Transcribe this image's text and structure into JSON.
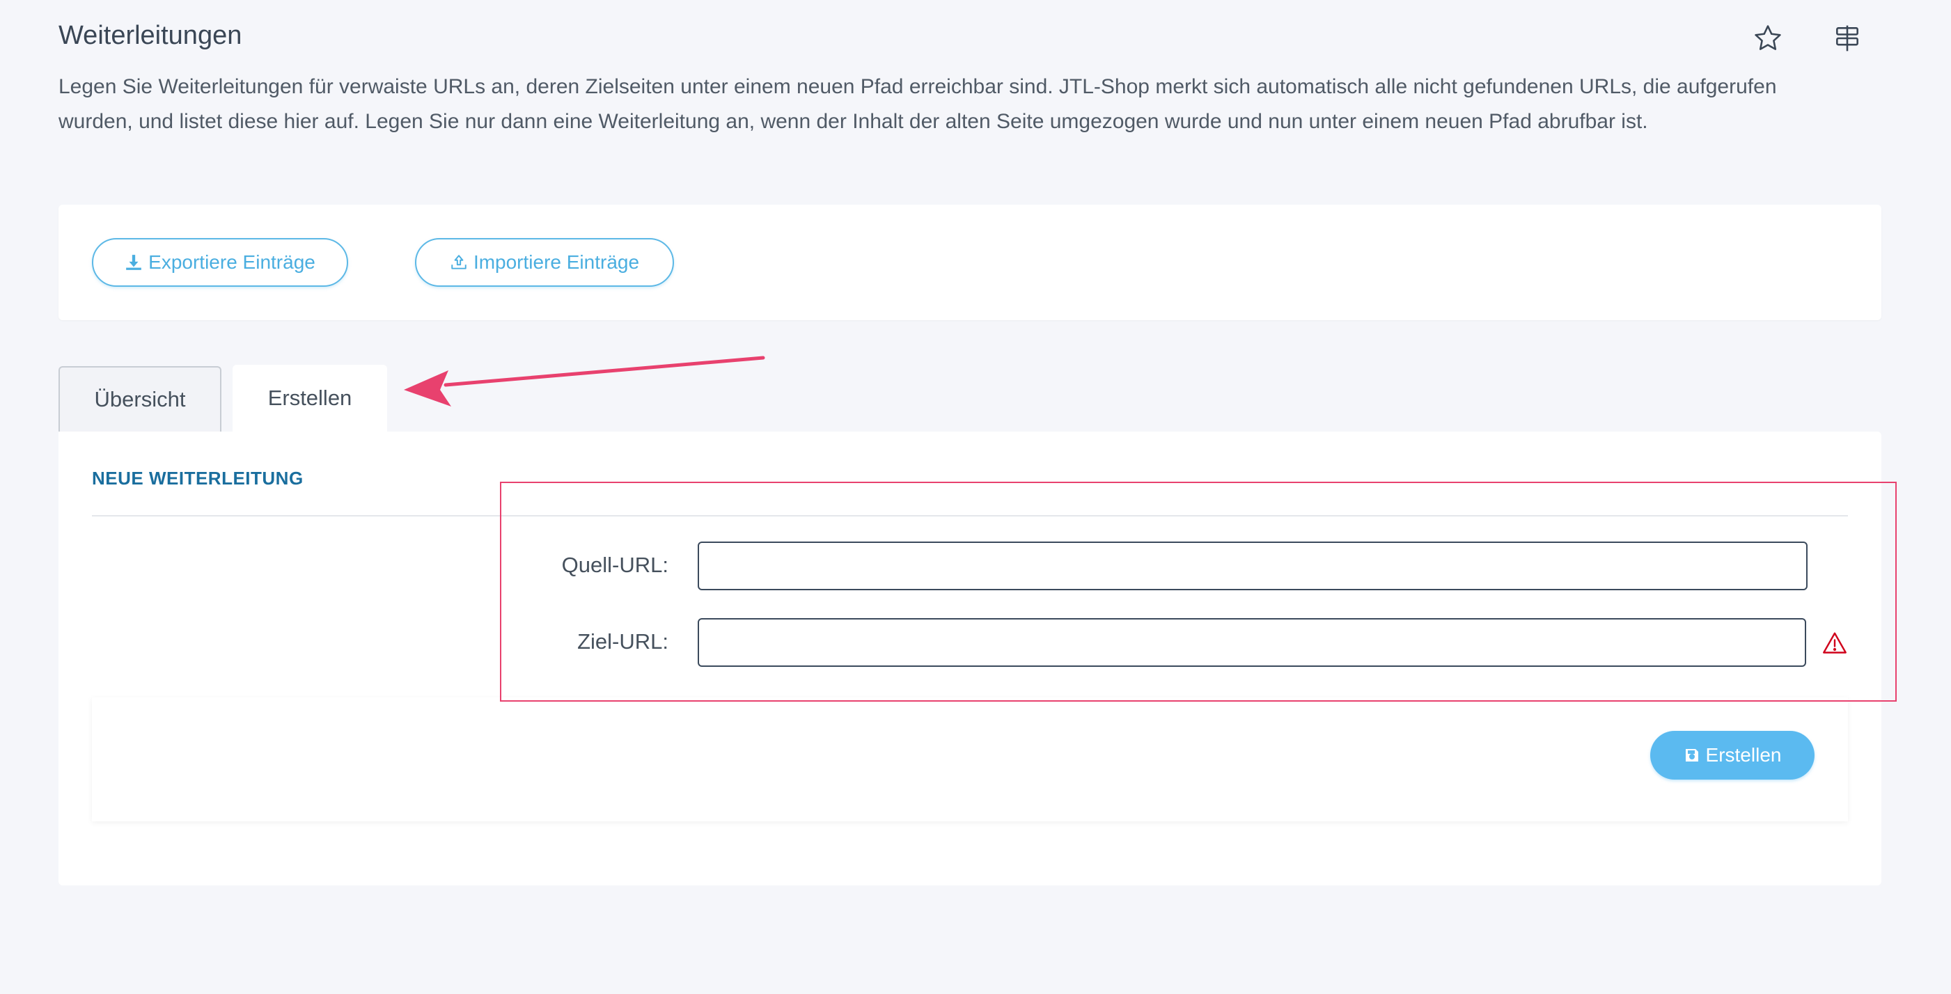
{
  "page": {
    "title": "Weiterleitungen",
    "description": "Legen Sie Weiterleitungen für verwaiste URLs an, deren Zielseiten unter einem neuen Pfad erreichbar sind. JTL-Shop merkt sich automatisch alle nicht gefundenen URLs, die aufgerufen wurden, und listet diese hier auf. Legen Sie nur dann eine Weiterleitung an, wenn der Inhalt der alten Seite umgezogen wurde und nun unter einem neuen Pfad abrufbar ist."
  },
  "header_icons": [
    "star-icon",
    "signpost-icon"
  ],
  "actions": {
    "export_label": "Exportiere Einträge",
    "import_label": "Importiere Einträge"
  },
  "tabs": [
    {
      "label": "Übersicht",
      "active": false
    },
    {
      "label": "Erstellen",
      "active": true
    }
  ],
  "form": {
    "section_title": "NEUE WEITERLEITUNG",
    "source_label": "Quell-URL:",
    "source_value": "",
    "target_label": "Ziel-URL:",
    "target_value": "",
    "submit_label": "Erstellen"
  },
  "colors": {
    "accent": "#5bbaf0",
    "section_title": "#1a6e9e",
    "annotation": "#e8416e",
    "warning": "#d0021b"
  }
}
